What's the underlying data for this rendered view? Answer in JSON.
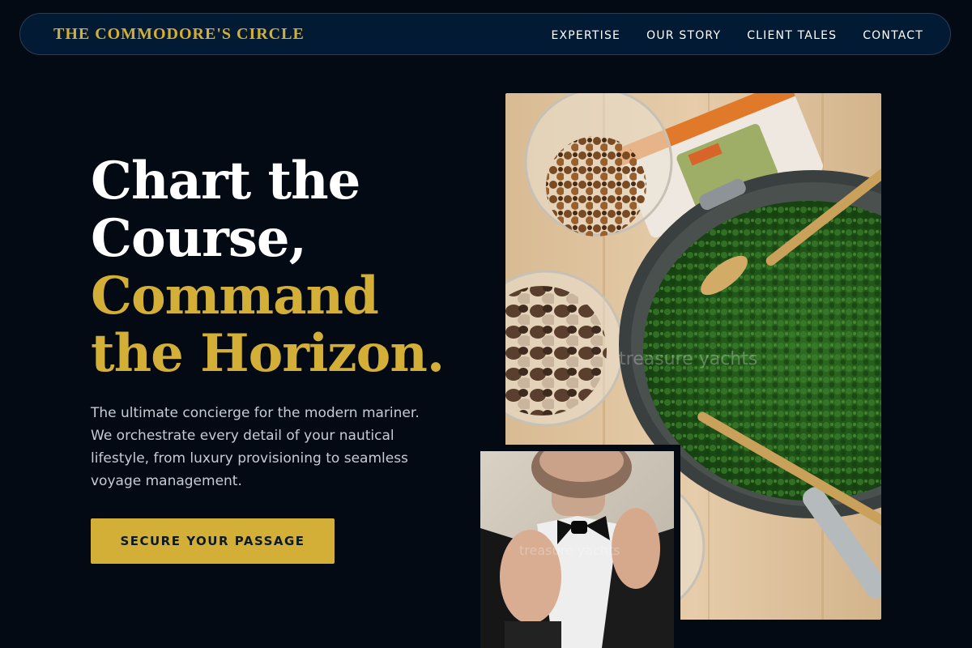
{
  "nav": {
    "brand": "THE COMMODORE'S CIRCLE",
    "items": [
      {
        "label": "EXPERTISE"
      },
      {
        "label": "OUR STORY"
      },
      {
        "label": "CLIENT TALES"
      },
      {
        "label": "CONTACT"
      }
    ]
  },
  "hero": {
    "headline": {
      "line1": "Chart the",
      "line2": "Course,",
      "line3": "Command",
      "line4": "the Horizon."
    },
    "lead_line1": "The ultimate concierge for the modern mariner.",
    "lead_line2": "We orchestrate every detail of your nautical",
    "lead_line3": "lifestyle, from luxury provisioning to seamless",
    "lead_line4": "voyage management.",
    "cta_label": "SECURE YOUR PASSAGE"
  },
  "images": {
    "main_watermark": "treasure yachts",
    "secondary_watermark": "treasure yachts"
  },
  "colors": {
    "background": "#030a14",
    "nav_background": "#021a33",
    "accent_gold": "#d4af37",
    "text_muted": "#c7ccd3"
  }
}
